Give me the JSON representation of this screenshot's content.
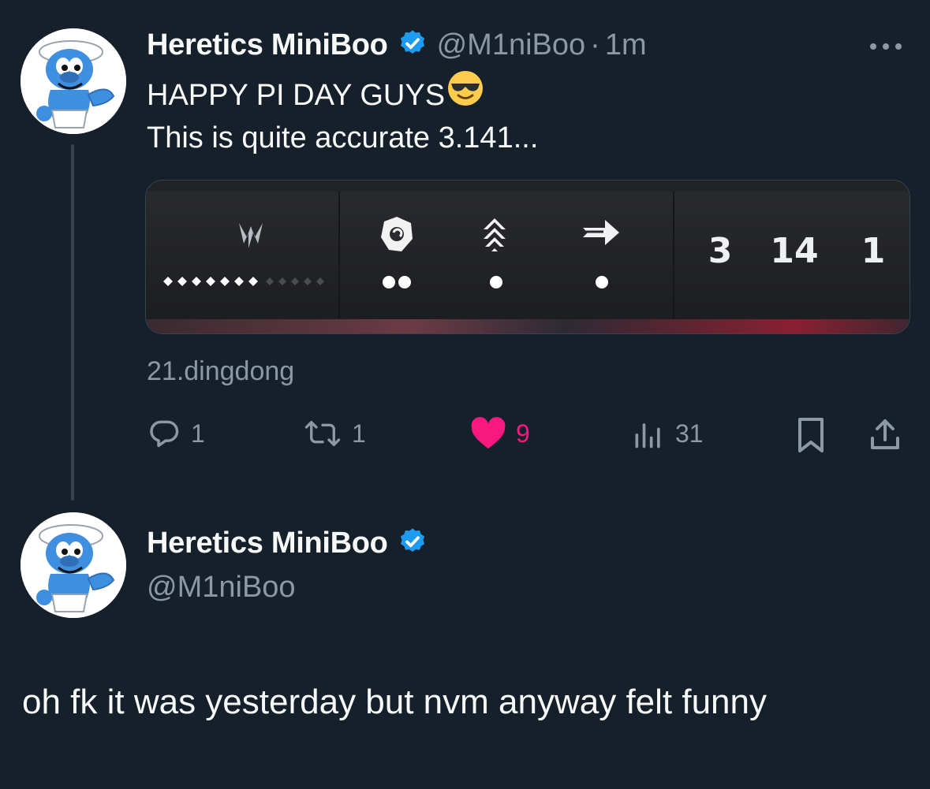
{
  "tweet": {
    "author_name": "Heretics MiniBoo",
    "handle": "@M1niBoo",
    "separator": "·",
    "time": "1m",
    "more_menu": "more-horizontal-icon",
    "text_line1": "HAPPY PI DAY GUYS",
    "emoji": "😎",
    "text_line2": "This is quite accurate 3.141...",
    "media": {
      "numbers": [
        "3",
        "14",
        "1"
      ]
    },
    "source": "21.dingdong",
    "actions": {
      "replies": "1",
      "retweets": "1",
      "likes": "9",
      "views": "31"
    }
  },
  "reply": {
    "author_name": "Heretics MiniBoo",
    "handle": "@M1niBoo",
    "text": "oh fk it was yesterday but nvm anyway felt funny"
  },
  "colors": {
    "background": "#15202b",
    "verified": "#1d9bf0",
    "like": "#f91880",
    "muted": "#8b98a5"
  }
}
